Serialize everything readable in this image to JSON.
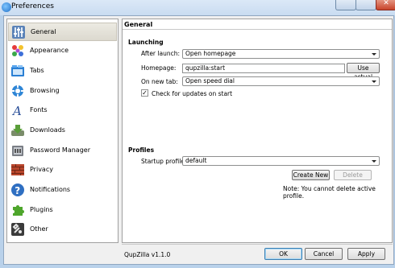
{
  "window": {
    "title": "Preferences"
  },
  "sidebar": {
    "items": [
      {
        "label": "General",
        "icon": "general-sliders-icon",
        "selected": true
      },
      {
        "label": "Appearance",
        "icon": "appearance-palette-icon",
        "selected": false
      },
      {
        "label": "Tabs",
        "icon": "tabs-icon",
        "selected": false
      },
      {
        "label": "Browsing",
        "icon": "browsing-globe-icon",
        "selected": false
      },
      {
        "label": "Fonts",
        "icon": "fonts-letter-icon",
        "selected": false
      },
      {
        "label": "Downloads",
        "icon": "downloads-icon",
        "selected": false
      },
      {
        "label": "Password Manager",
        "icon": "password-manager-icon",
        "selected": false
      },
      {
        "label": "Privacy",
        "icon": "privacy-wall-icon",
        "selected": false
      },
      {
        "label": "Notifications",
        "icon": "notifications-help-icon",
        "selected": false
      },
      {
        "label": "Plugins",
        "icon": "plugins-puzzle-icon",
        "selected": false
      },
      {
        "label": "Other",
        "icon": "other-tools-icon",
        "selected": false
      }
    ]
  },
  "panel": {
    "title": "General",
    "launching": {
      "heading": "Launching",
      "after_launch_label": "After launch:",
      "after_launch_value": "Open homepage",
      "homepage_label": "Homepage:",
      "homepage_value": "qupzilla:start",
      "use_actual_label": "Use actual",
      "new_tab_label": "On new tab:",
      "new_tab_value": "Open speed dial",
      "check_updates_label": "Check for updates on start",
      "check_updates_checked": true
    },
    "profiles": {
      "heading": "Profiles",
      "startup_label": "Startup profile:",
      "startup_value": "default",
      "create_new_label": "Create New",
      "delete_label": "Delete",
      "note": "Note: You cannot delete active profile."
    }
  },
  "footer": {
    "version": "QupZilla v1.1.0",
    "ok_label": "OK",
    "cancel_label": "Cancel",
    "apply_label": "Apply"
  },
  "colors": {
    "titlebar": "#c9dcf1",
    "selection": "#dcd9cf",
    "accent": "#3c7fb1",
    "close_button": "#c8442b"
  }
}
